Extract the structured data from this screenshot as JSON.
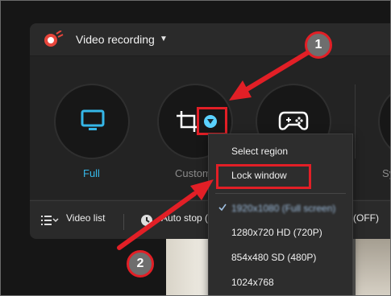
{
  "app": {
    "title": "Video recording",
    "title_caret": "▼"
  },
  "modes": [
    {
      "label": "Full",
      "icon": "monitor-icon",
      "color": "#35b7e8"
    },
    {
      "label": "Custom",
      "icon": "crop-icon"
    },
    {
      "label": "",
      "icon": "gamepad-icon"
    },
    {
      "label": "Sy",
      "icon": "system-icon"
    }
  ],
  "toolbar": {
    "video_list": "Video list",
    "auto_stop": "Auto stop (",
    "off": "(OFF)"
  },
  "dropdown": {
    "items": [
      {
        "label": "Select region"
      },
      {
        "label": "Lock window"
      },
      {
        "label": "1920x1080 (Full screen)",
        "checked": true
      },
      {
        "label": "1280x720 HD (720P)"
      },
      {
        "label": "854x480 SD (480P)"
      },
      {
        "label": "1024x768"
      }
    ]
  },
  "annotations": {
    "badge1": "1",
    "badge2": "2",
    "accent_red": "#e21f26"
  }
}
